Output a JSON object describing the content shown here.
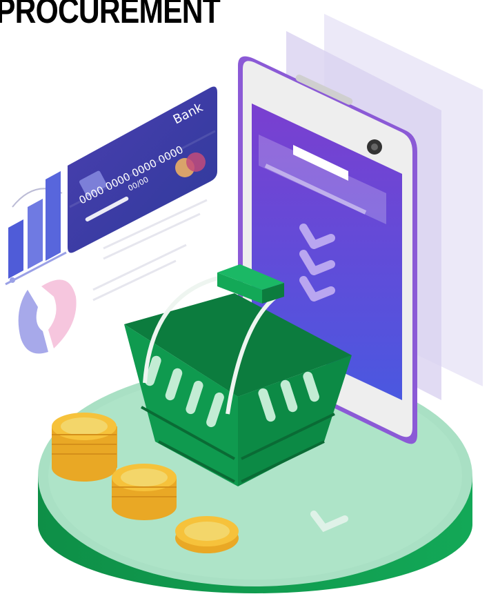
{
  "title": "PROCUREMENT",
  "card": {
    "bank_label": "Bank",
    "number": "0000 0000 0000 0000",
    "expiry": "00/00"
  },
  "colors": {
    "green": "#0f9a4f",
    "green_dark": "#0a7a3d",
    "platform_top": "#a9e0c4",
    "purple": "#6f3fd6",
    "card_blue": "#3b3aa8",
    "coin": "#f6c23b"
  },
  "icons": [
    "bar-chart-icon",
    "donut-chart-icon",
    "credit-card-icon",
    "shopping-basket-icon",
    "coin-icon",
    "checkmark-icon",
    "smartphone-icon"
  ]
}
